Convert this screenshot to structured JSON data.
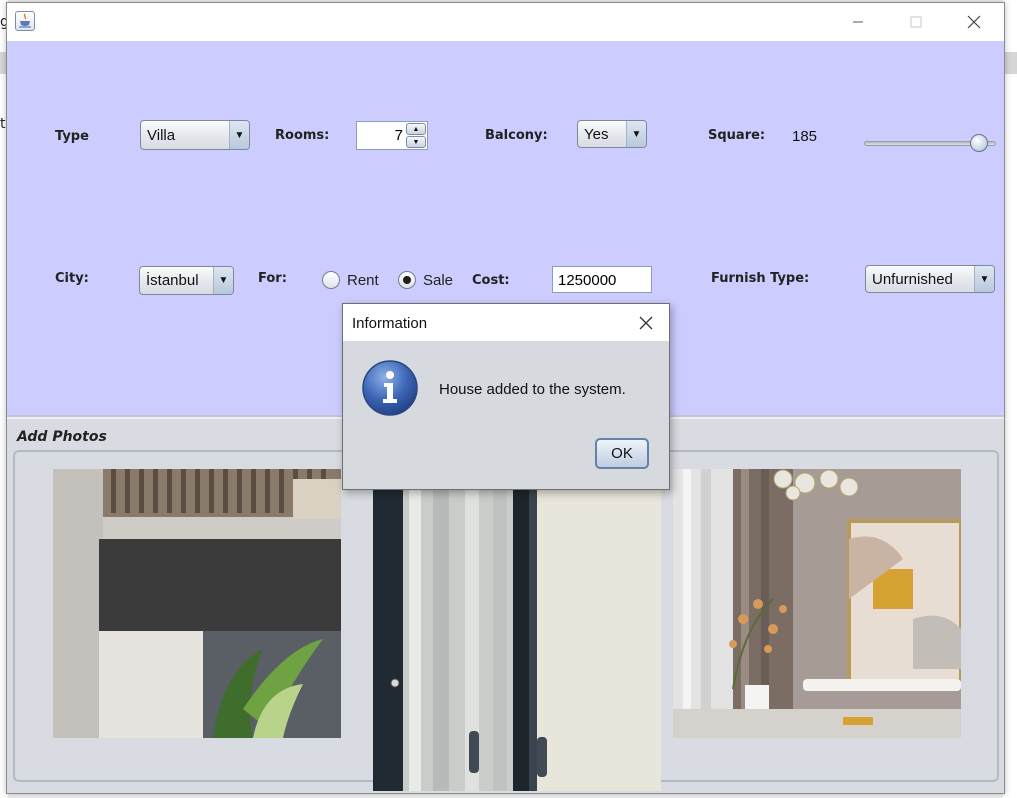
{
  "background": {
    "left_letters": [
      "g",
      "t"
    ]
  },
  "window": {
    "icon": "java-cup-icon"
  },
  "form": {
    "type_label": "Type",
    "type_value": "Villa",
    "rooms_label": "Rooms:",
    "rooms_value": "7",
    "balcony_label": "Balcony:",
    "balcony_value": "Yes",
    "square_label": "Square:",
    "square_value": "185",
    "city_label": "City:",
    "city_value": "İstanbul",
    "for_label": "For:",
    "for_options": [
      "Rent",
      "Sale"
    ],
    "for_selected": "Sale",
    "cost_label": "Cost:",
    "cost_value": "1250000",
    "furnish_label": "Furnish Type:",
    "furnish_value": "Unfurnished",
    "square_slider_fraction": 0.92
  },
  "photos": {
    "title": "Add Photos"
  },
  "dialog": {
    "title": "Information",
    "message": "House added to the system.",
    "ok_label": "OK",
    "icon": "info-icon"
  },
  "colors": {
    "form_background": "#ccccff",
    "photos_background": "#d8dbe1",
    "dialog_background": "#d6d9de"
  }
}
